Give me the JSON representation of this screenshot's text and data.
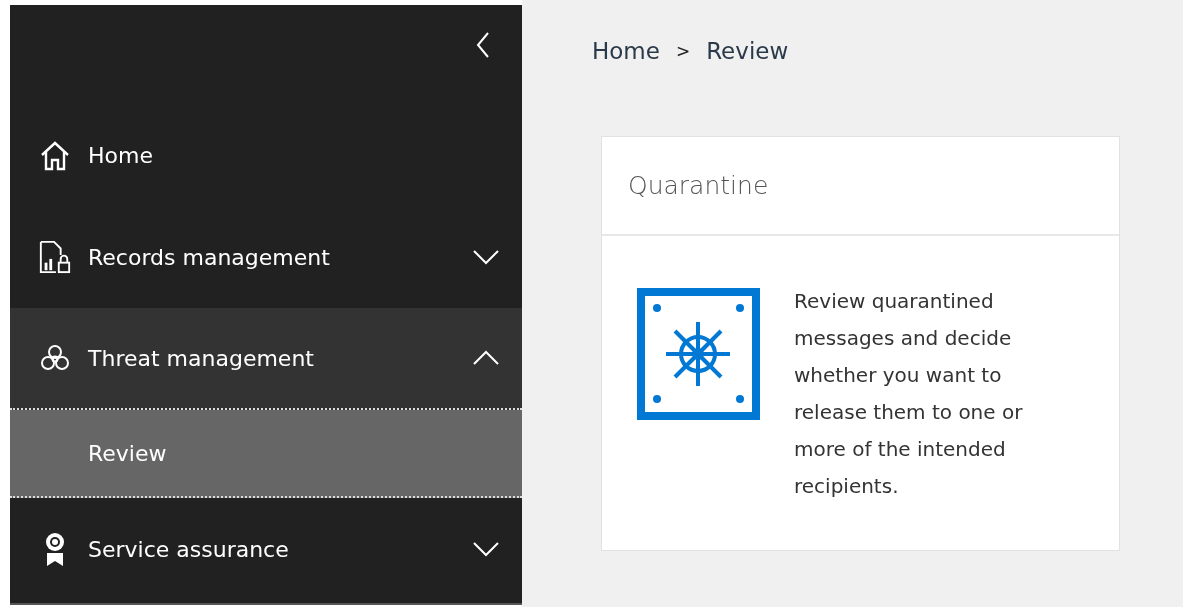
{
  "sidebar": {
    "items": [
      {
        "label": "Home"
      },
      {
        "label": "Records management",
        "expanded": false
      },
      {
        "label": "Threat management",
        "expanded": true,
        "children": [
          {
            "label": "Review",
            "selected": true
          }
        ]
      },
      {
        "label": "Service assurance",
        "expanded": false
      }
    ]
  },
  "breadcrumb": [
    "Home",
    "Review"
  ],
  "breadcrumb_separator": ">",
  "card": {
    "title": "Quarantine",
    "description": "Review quarantined messages and decide whether you want to release them to one or more of the intended recipients."
  }
}
